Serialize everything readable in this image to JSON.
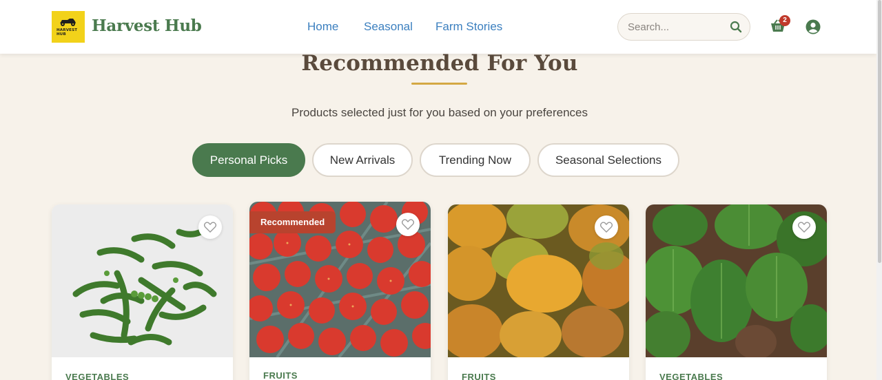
{
  "header": {
    "logo_text_line1": "HARVEST",
    "logo_text_line2": "HUB",
    "brand": "Harvest Hub",
    "nav": [
      "Home",
      "Seasonal",
      "Farm Stories"
    ],
    "search_placeholder": "Search...",
    "cart_count": "2"
  },
  "section": {
    "title": "Recommended For You",
    "subtitle": "Products selected just for you based on your preferences",
    "tabs": [
      "Personal Picks",
      "New Arrivals",
      "Trending Now",
      "Seasonal Selections"
    ],
    "active_tab": "Personal Picks"
  },
  "products": [
    {
      "category": "VEGETABLES",
      "badge": "",
      "image": "green peas"
    },
    {
      "category": "FRUITS",
      "badge": "Recommended",
      "image": "strawberries"
    },
    {
      "category": "FRUITS",
      "badge": "",
      "image": "mangoes"
    },
    {
      "category": "VEGETABLES",
      "badge": "",
      "image": "spinach"
    }
  ],
  "colors": {
    "brand_green": "#4a7a4e",
    "nav_blue": "#3b7fbf",
    "accent_gold": "#d4a843",
    "badge_red": "#b8432e",
    "background": "#f7f2ea"
  }
}
